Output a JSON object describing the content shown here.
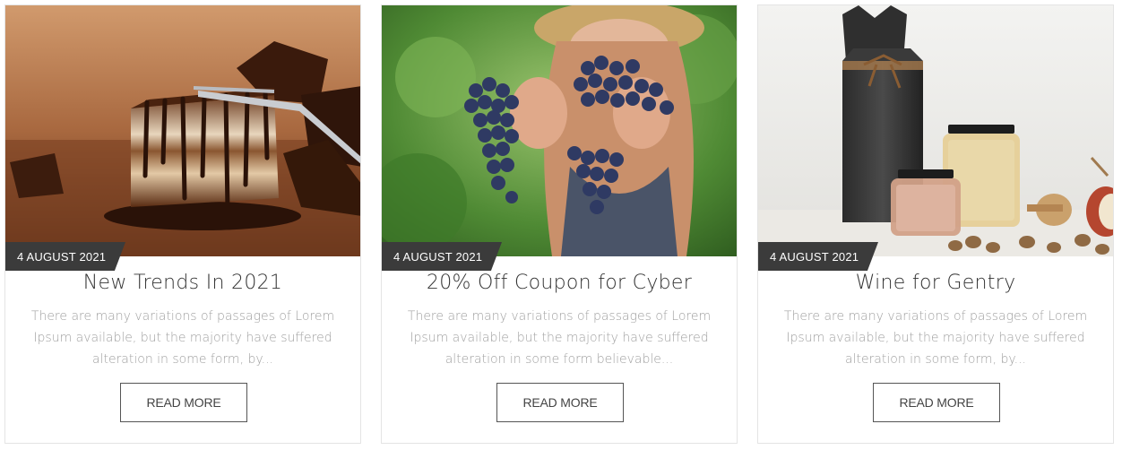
{
  "posts": [
    {
      "date": "4 AUGUST 2021",
      "title": "New Trends In 2021",
      "excerpt": "There are many variations of passages of Lorem Ipsum available, but the majority have suffered alteration in some form, by...",
      "button": "READ MORE",
      "image_subject": "chocolate-cake-image"
    },
    {
      "date": "4 AUGUST 2021",
      "title": "20% Off Coupon for Cyber",
      "excerpt": "There are many variations of passages of Lorem Ipsum available, but the majority have suffered alteration in some form believable...",
      "button": "READ MORE",
      "image_subject": "grapes-image"
    },
    {
      "date": "4 AUGUST 2021",
      "title": "Wine for Gentry",
      "excerpt": "There are many variations of passages of Lorem Ipsum available, but the majority have suffered alteration in some form, by...",
      "button": "READ MORE",
      "image_subject": "honey-jars-image"
    }
  ],
  "colors": {
    "date_tag_bg": "#3b3b3b",
    "title_text": "#333333",
    "excerpt_text": "#a1a1a1",
    "button_border": "#555555"
  }
}
